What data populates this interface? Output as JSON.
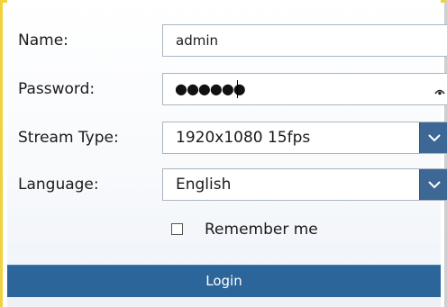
{
  "form": {
    "name": {
      "label": "Name:",
      "value": "admin"
    },
    "password": {
      "label": "Password:",
      "masked_value": "●●●●●●",
      "toggle_icon": "eye-icon"
    },
    "stream_type": {
      "label": "Stream Type:",
      "selected": "1920x1080 15fps",
      "dropdown_icon": "chevron-down-icon"
    },
    "language": {
      "label": "Language:",
      "selected": "English",
      "dropdown_icon": "chevron-down-icon"
    },
    "remember_me": {
      "label": "Remember me",
      "checked": false
    },
    "login_button": {
      "label": "Login"
    }
  },
  "colors": {
    "accent": "#2c6599",
    "dropdown_button": "#3d6794",
    "field_border": "#a9b6c3",
    "frame_highlight": "#f0d23c"
  }
}
